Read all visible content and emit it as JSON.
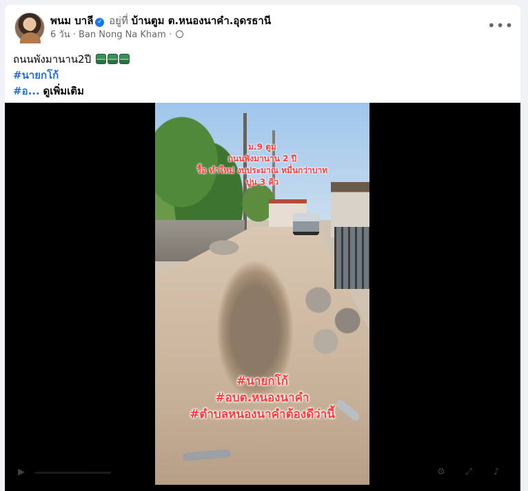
{
  "post": {
    "author": "พนม บาลี",
    "verified_mark": "✓",
    "at_label": "อยู่ที่",
    "place": "บ้านตูม ต.หนองนาคำ.อุดรธานี",
    "time": "6 วัน",
    "separator": "·",
    "location_name": "Ban Nong Na Kham",
    "separator2": "·",
    "privacy_icon": "globe-icon",
    "more_label": "•••",
    "text_line1": "ถนนพังมานาน2ปี",
    "hashtag1": "#นายกโก้",
    "hashtag2_truncated": "#อ...",
    "see_more": "ดูเพิ่มเติม"
  },
  "video": {
    "overlay_top": [
      "ม.9 ตูม",
      "ถนนพังมานาน 2 ปี",
      "รื้อ ทำใหม่ งบประมาณ หมื่นกว่าบาท",
      "ปูน 3 คิว"
    ],
    "overlay_bottom": [
      "#นายกโก้",
      "#อบต.หนองนาคำ",
      "#ตำบลหนองนาคำต้องดีว่านี้"
    ]
  },
  "colors": {
    "link": "#216fdb",
    "verified": "#1877f2",
    "overlay_text": "#ff3b3b",
    "secondary_text": "#65676b"
  }
}
